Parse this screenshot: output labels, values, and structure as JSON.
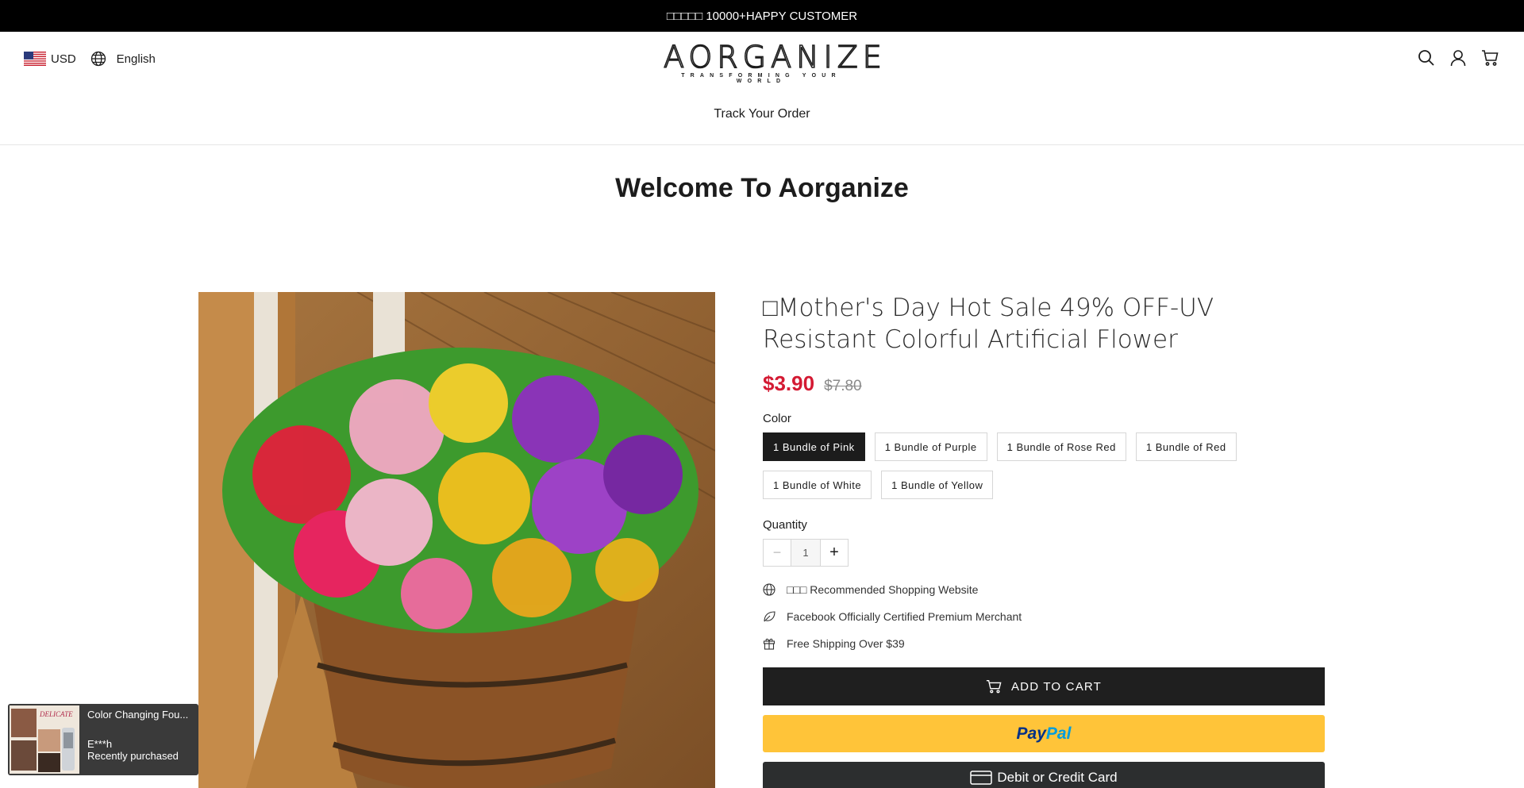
{
  "announcement": "□□□□□ 10000+HAPPY CUSTOMER",
  "header": {
    "currency": "USD",
    "language": "English",
    "logo_text": "AORGANIZE",
    "logo_tagline": "TRANSFORMING YOUR WORLD",
    "icons": [
      "search-icon",
      "account-icon",
      "cart-icon"
    ]
  },
  "nav": {
    "track_order": "Track Your Order"
  },
  "welcome": "Welcome To Aorganize",
  "product": {
    "title": "□Mother's Day Hot Sale 49% OFF-UV Resistant Colorful Artificial Flower",
    "price": "$3.90",
    "compare_price": "$7.80",
    "color_label": "Color",
    "colors": [
      {
        "label": "1 Bundle of Pink",
        "selected": true
      },
      {
        "label": "1 Bundle of Purple",
        "selected": false
      },
      {
        "label": "1 Bundle of Rose Red",
        "selected": false
      },
      {
        "label": "1 Bundle of Red",
        "selected": false
      },
      {
        "label": "1 Bundle of White",
        "selected": false
      },
      {
        "label": "1 Bundle of Yellow",
        "selected": false
      }
    ],
    "quantity_label": "Quantity",
    "quantity": "1",
    "features": [
      {
        "icon": "globe-icon",
        "text": "□□□ Recommended Shopping Website"
      },
      {
        "icon": "leaf-icon",
        "text": "Facebook Officially Certified Premium Merchant"
      },
      {
        "icon": "gift-icon",
        "text": "Free Shipping Over $39"
      }
    ],
    "add_to_cart": "ADD TO CART",
    "paypal_part1": "Pay",
    "paypal_part2": "Pal",
    "card_button": "Debit or Credit Card"
  },
  "toast": {
    "product": "Color Changing Fou...",
    "buyer": "E***h",
    "status": "Recently purchased",
    "thumb_text": "DELICATE"
  },
  "colors": {
    "accent_price": "#d41a33",
    "paypal": "#ffc439",
    "dark": "#1f1f1f"
  }
}
